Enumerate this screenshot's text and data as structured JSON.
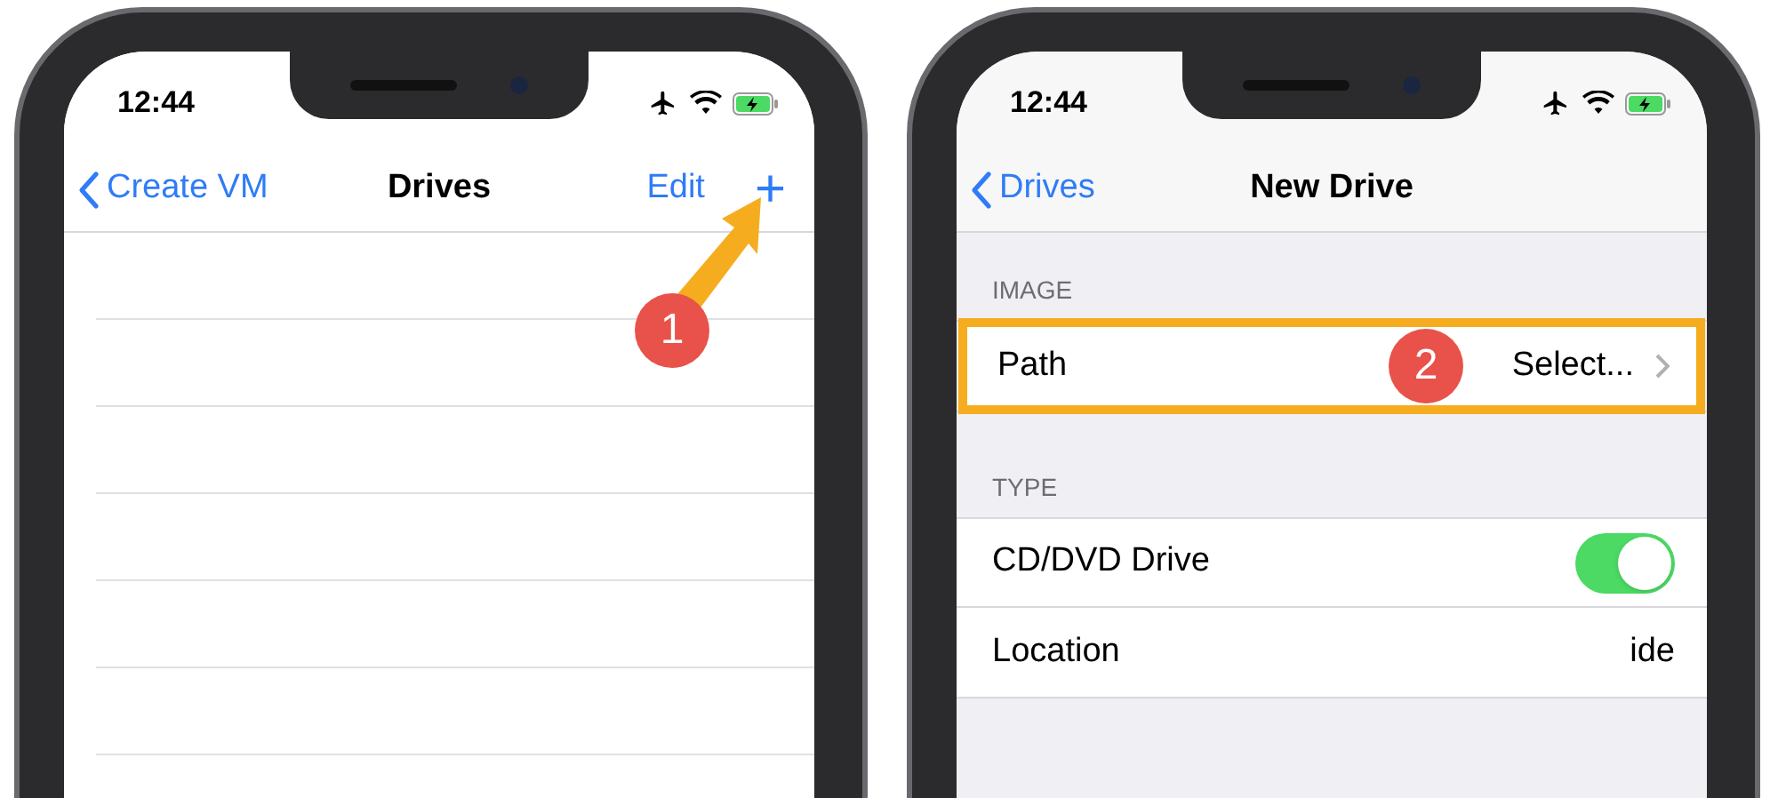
{
  "phones": [
    {
      "kind": "list",
      "status": {
        "time": "12:44"
      },
      "nav": {
        "back": "Create VM",
        "title": "Drives",
        "actions": [
          "Edit",
          "+"
        ]
      },
      "callout": {
        "kind": "arrow",
        "label": "1"
      }
    },
    {
      "kind": "form",
      "status": {
        "time": "12:44"
      },
      "nav": {
        "back": "Drives",
        "title": "New Drive"
      },
      "callout": {
        "kind": "highlight",
        "label": "2"
      },
      "sections": [
        {
          "header": "IMAGE",
          "rows": [
            {
              "kind": "detail",
              "label": "Path",
              "value": "Select...",
              "highlighted": true
            }
          ]
        },
        {
          "header": "TYPE",
          "rows": [
            {
              "kind": "toggle",
              "label": "CD/DVD Drive",
              "on": true
            },
            {
              "kind": "value",
              "label": "Location",
              "value": "ide"
            }
          ]
        }
      ]
    }
  ]
}
